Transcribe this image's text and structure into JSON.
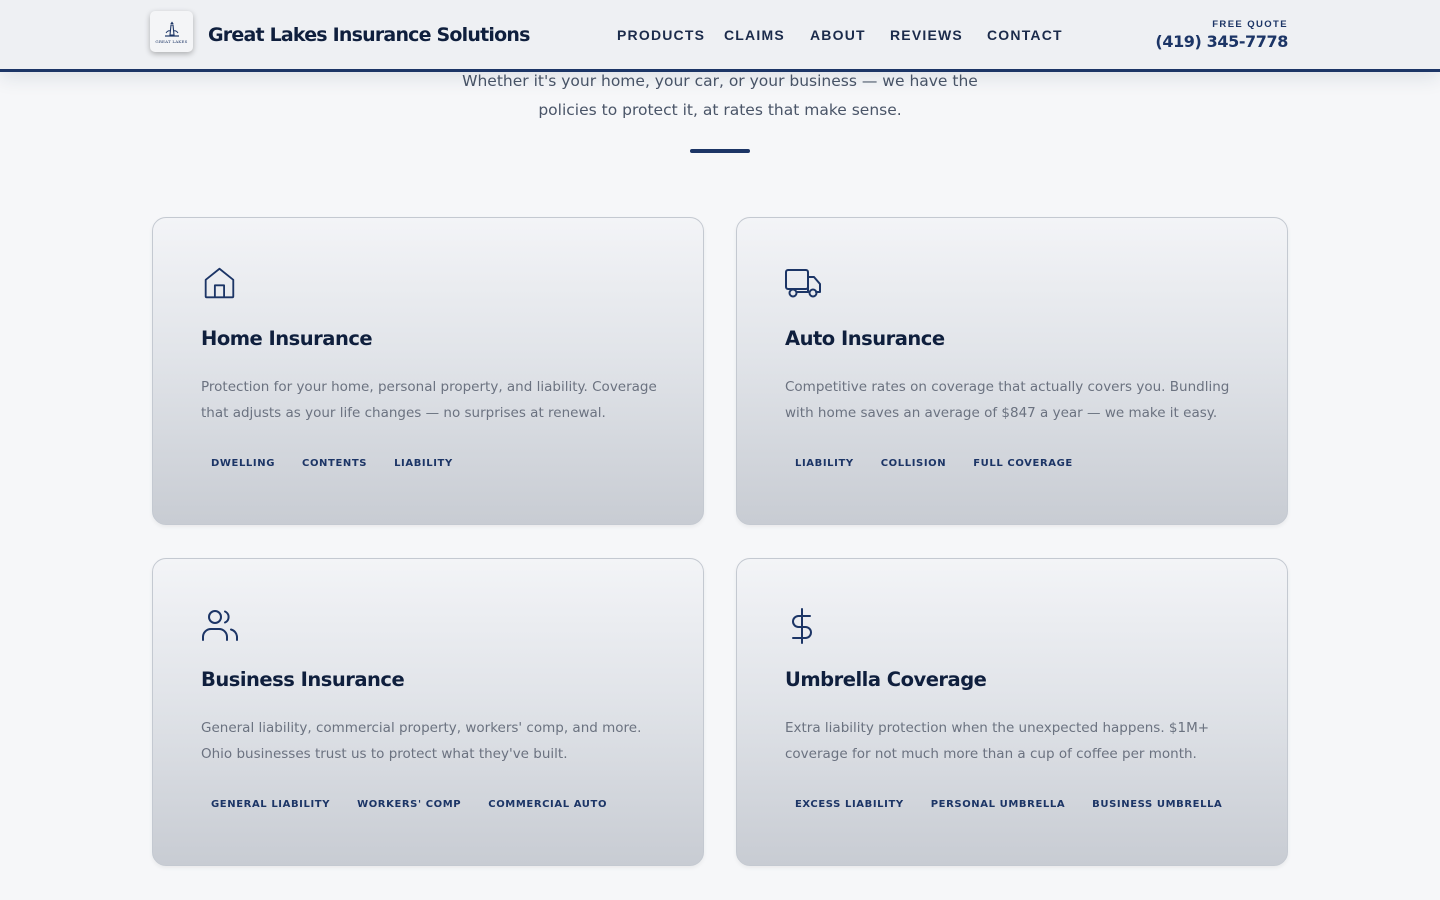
{
  "header": {
    "logo_text": "GREAT LAKES",
    "brand": "Great Lakes Insurance Solutions",
    "nav": [
      "PRODUCTS",
      "CLAIMS",
      "ABOUT",
      "REVIEWS",
      "CONTACT"
    ],
    "quote_label": "FREE QUOTE",
    "quote_phone": "(419) 345-7778"
  },
  "intro": {
    "line1": "Whether it's your home, your car, or your business — we have the",
    "line2": "policies to protect it, at rates that make sense."
  },
  "cards": [
    {
      "icon": "home-icon",
      "title": "Home Insurance",
      "desc": "Protection for your home, personal property, and liability. Coverage that adjusts as your life changes — no surprises at renewal.",
      "tags": [
        "DWELLING",
        "CONTENTS",
        "LIABILITY"
      ]
    },
    {
      "icon": "truck-icon",
      "title": "Auto Insurance",
      "desc": "Competitive rates on coverage that actually covers you. Bundling with home saves an average of $847 a year — we make it easy.",
      "tags": [
        "LIABILITY",
        "COLLISION",
        "FULL COVERAGE"
      ]
    },
    {
      "icon": "users-icon",
      "title": "Business Insurance",
      "desc": "General liability, commercial property, workers' comp, and more. Ohio businesses trust us to protect what they've built.",
      "tags": [
        "GENERAL LIABILITY",
        "WORKERS' COMP",
        "COMMERCIAL AUTO"
      ]
    },
    {
      "icon": "dollar-icon",
      "title": "Umbrella Coverage",
      "desc": "Extra liability protection when the unexpected happens. $1M+ coverage for not much more than a cup of coffee per month.",
      "tags": [
        "EXCESS LIABILITY",
        "PERSONAL UMBRELLA",
        "BUSINESS UMBRELLA"
      ]
    }
  ],
  "colors": {
    "navy": "#1c3566",
    "heading": "#0f1f3d",
    "body_text": "#6b7280",
    "page_bg": "#f6f7f9"
  }
}
